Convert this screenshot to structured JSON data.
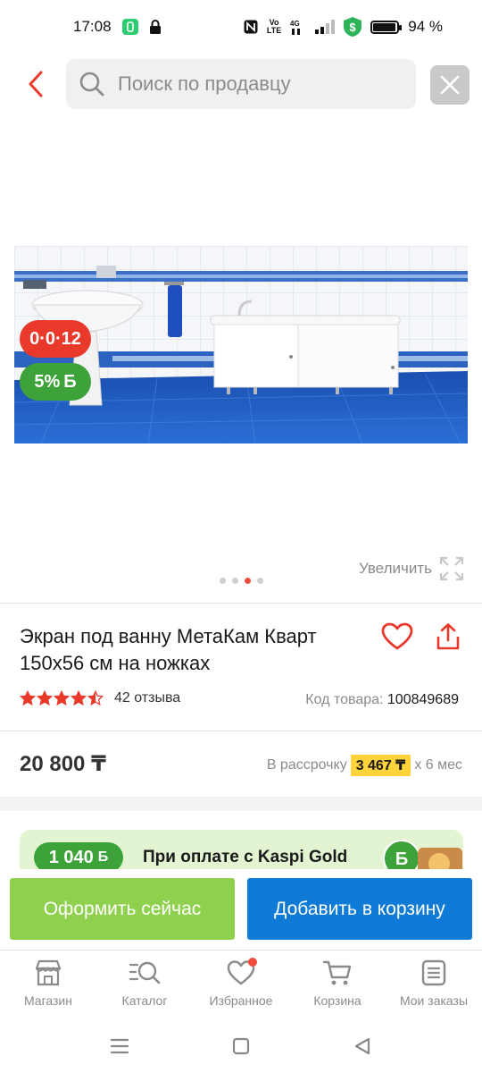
{
  "status_bar": {
    "time": "17:08",
    "battery": "94 %",
    "battery_level": 0.94,
    "network": "4G",
    "volte": "VoLTE"
  },
  "search": {
    "placeholder": "Поиск по продавцу"
  },
  "gallery": {
    "badge_installment": "0·0·12",
    "badge_bonus": "5%",
    "badge_bonus_symbol": "Б",
    "zoom_label": "Увеличить",
    "active_slide": 3,
    "slide_count": 4
  },
  "product": {
    "title": "Экран под ванну МетаКам Кварт 150х56 см на ножках",
    "rating": 4.5,
    "reviews": "42 отзыва",
    "sku_label": "Код товара:",
    "sku_value": "100849689"
  },
  "price": {
    "value": "20 800 ₸",
    "installment_prefix": "В рассрочку",
    "installment_amount": "3 467 ₸",
    "installment_suffix": "х 6 мес"
  },
  "kaspi_gold": {
    "bonus": "1 040",
    "bonus_symbol": "Б",
    "text": "При оплате с Kaspi Gold"
  },
  "actions": {
    "buy_now": "Оформить сейчас",
    "add_to_cart": "Добавить в корзину"
  },
  "bottom_nav": [
    {
      "label": "Магазин",
      "icon": "store-icon"
    },
    {
      "label": "Каталог",
      "icon": "catalog-search-icon"
    },
    {
      "label": "Избранное",
      "icon": "heart-icon"
    },
    {
      "label": "Корзина",
      "icon": "cart-icon"
    },
    {
      "label": "Мои заказы",
      "icon": "orders-icon"
    }
  ],
  "colors": {
    "accent_red": "#e8392b",
    "bonus_green": "#3ea23a",
    "buy_now_green": "#8fd14f",
    "cart_blue": "#0f7bd6",
    "installment_yellow": "#ffd43b"
  }
}
